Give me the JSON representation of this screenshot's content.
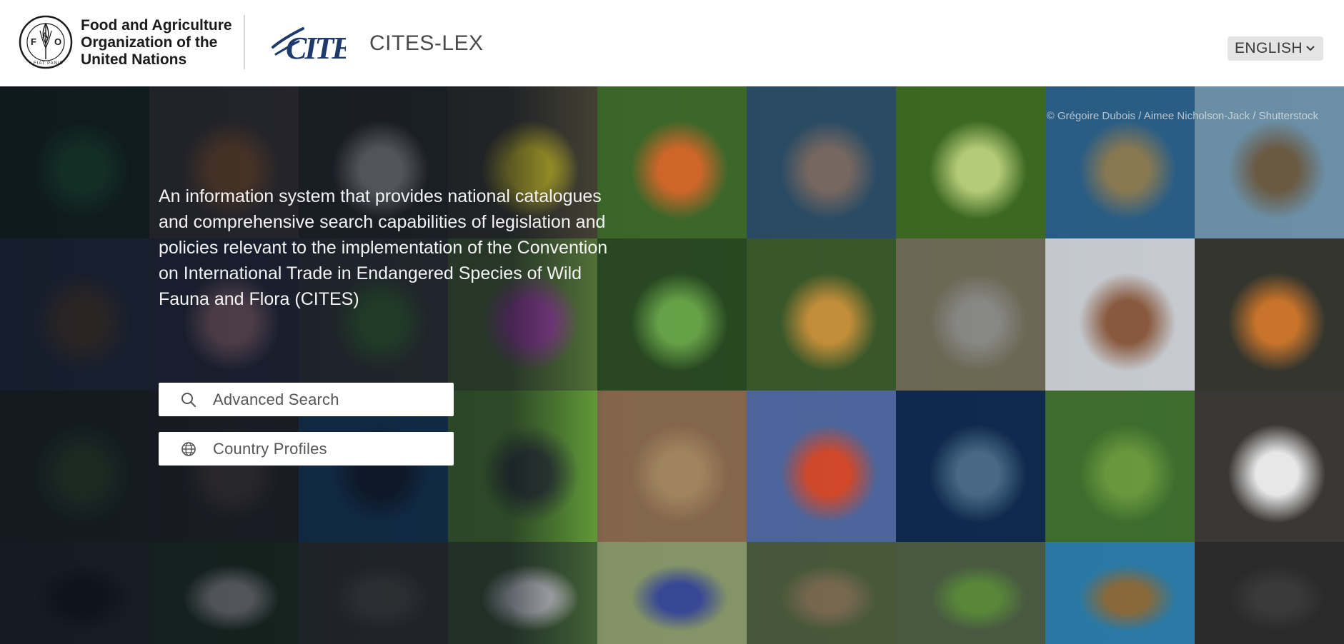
{
  "header": {
    "org_name_lines": [
      "Food and Agriculture",
      "Organization of the",
      "United Nations"
    ],
    "emblem_letters": [
      "F",
      "A",
      "O"
    ],
    "emblem_motto": "FIAT PANIS",
    "cites_logo_text": "CITES",
    "app_title": "CITES-LEX",
    "language_selected": "ENGLISH"
  },
  "hero": {
    "photo_credit": "© Grégoire Dubois / Aimee Nicholson-Jack / Shutterstock",
    "intro_text": "An information system that provides national catalogues and comprehensive search capabilities of legislation and policies relevant to the implementation of the Convention on International Trade in Endangered Species of Wild Fauna and Flora (CITES)",
    "buttons": [
      {
        "label": "Advanced Search",
        "icon": "search-icon"
      },
      {
        "label": "Country Profiles",
        "icon": "globe-icon"
      }
    ],
    "tiles": [
      {
        "subject": "hummingbird",
        "bg": "#1f3a22",
        "fg": "#2e7a3a"
      },
      {
        "subject": "tiger",
        "bg": "#5a5046",
        "fg": "#c27a3a"
      },
      {
        "subject": "monkey",
        "bg": "#3a3a34",
        "fg": "#d8d4c8"
      },
      {
        "subject": "poison-dart-frog",
        "bg": "#4a4636",
        "fg": "#e6d62a"
      },
      {
        "subject": "caracara",
        "bg": "#3f6b2a",
        "fg": "#d86a2a"
      },
      {
        "subject": "hippo",
        "bg": "#2c4d66",
        "fg": "#7a6a62"
      },
      {
        "subject": "tree-frog",
        "bg": "#3e6a22",
        "fg": "#b8d07a"
      },
      {
        "subject": "shark-water",
        "bg": "#2a5e86",
        "fg": "#8a7a52"
      },
      {
        "subject": "baobab",
        "bg": "#6b8fa6",
        "fg": "#6a5a42"
      },
      {
        "subject": "eagle",
        "bg": "#3a4456",
        "fg": "#7a5a3a"
      },
      {
        "subject": "dolphin-flamingo",
        "bg": "#3c4052",
        "fg": "#d89aa0"
      },
      {
        "subject": "parakeet",
        "bg": "#4a4a46",
        "fg": "#4a8a3a"
      },
      {
        "subject": "orchid",
        "bg": "#5a7a3a",
        "fg": "#a84aa8"
      },
      {
        "subject": "forest-canopy",
        "bg": "#2a4a22",
        "fg": "#6aa84a"
      },
      {
        "subject": "jaguar",
        "bg": "#3a5a2a",
        "fg": "#c8923a"
      },
      {
        "subject": "elephant",
        "bg": "#6e6a56",
        "fg": "#8a8a86"
      },
      {
        "subject": "walrus",
        "bg": "#c8ccd2",
        "fg": "#8a5a3e"
      },
      {
        "subject": "salamander",
        "bg": "#34362e",
        "fg": "#c8742a"
      },
      {
        "subject": "bush",
        "bg": "#2e3a26",
        "fg": "#4a6a32"
      },
      {
        "subject": "tree-bark",
        "bg": "#3a3630",
        "fg": "#6a5a4a"
      },
      {
        "subject": "manta-ray",
        "bg": "#1e5a8a",
        "fg": "#1a2a3a"
      },
      {
        "subject": "green-frog",
        "bg": "#6aa83a",
        "fg": "#3a4a3a"
      },
      {
        "subject": "lynx",
        "bg": "#8a6a4e",
        "fg": "#a88a62"
      },
      {
        "subject": "lorikeet",
        "bg": "#4e68a0",
        "fg": "#d84a2a"
      },
      {
        "subject": "whale-shark",
        "bg": "#0e2a4e",
        "fg": "#4a6a86"
      },
      {
        "subject": "rainforest",
        "bg": "#3e6e2e",
        "fg": "#6a9a3e"
      },
      {
        "subject": "zebras",
        "bg": "#3a3836",
        "fg": "#e8e8e8"
      },
      {
        "subject": "gorilla",
        "bg": "#3a3a34",
        "fg": "#1e1e1c"
      },
      {
        "subject": "cockatoo",
        "bg": "#2e4a22",
        "fg": "#e8e4d8"
      },
      {
        "subject": "iguana",
        "bg": "#4a4a42",
        "fg": "#6a6a5a"
      },
      {
        "subject": "panda",
        "bg": "#4a6a3a",
        "fg": "#f0f0ee"
      },
      {
        "subject": "flycatcher",
        "bg": "#8a9a6a",
        "fg": "#3a4a9a"
      },
      {
        "subject": "gibbon",
        "bg": "#4a5a3a",
        "fg": "#7a6a52"
      },
      {
        "subject": "lizard",
        "bg": "#4a5a42",
        "fg": "#5a8a3a"
      },
      {
        "subject": "sea-turtle",
        "bg": "#2a7aa6",
        "fg": "#8a6a3a"
      },
      {
        "subject": "extra",
        "bg": "#2a2a2a",
        "fg": "#3a3a3a"
      }
    ]
  },
  "colors": {
    "header_bg": "#ffffff",
    "title_text": "#4a4a4a",
    "cites_blue": "#1e3a6a",
    "overlay": "#080e1c",
    "button_bg": "#ffffff"
  }
}
